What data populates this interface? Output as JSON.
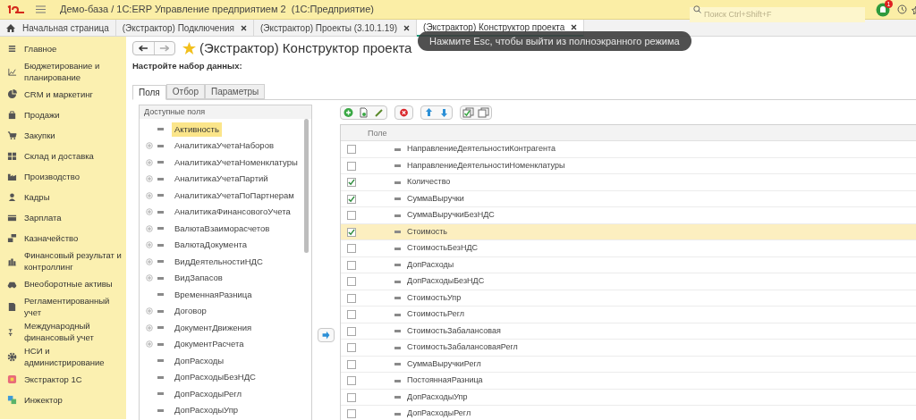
{
  "window": {
    "title": "Демо-база / 1С:ERP Управление предприятием 2  (1С:Предприятие)"
  },
  "search": {
    "placeholder": "Поиск Ctrl+Shift+F"
  },
  "notifications": {
    "count": "1"
  },
  "tabs": [
    {
      "label": "Начальная страница",
      "kind": "home",
      "selected": false
    },
    {
      "label": "(Экстрактор) Подключения",
      "kind": "doc",
      "selected": false
    },
    {
      "label": "(Экстрактор) Проекты (3.10.1.19)",
      "kind": "doc",
      "selected": false
    },
    {
      "label": "(Экстрактор) Конструктор проекта",
      "kind": "doc",
      "selected": true
    }
  ],
  "toast": "Нажмите Esc, чтобы выйти из полноэкранного режима",
  "sidebar": {
    "items": [
      {
        "label": "Главное"
      },
      {
        "label": "Бюджетирование и планирование"
      },
      {
        "label": "CRM и маркетинг"
      },
      {
        "label": "Продажи"
      },
      {
        "label": "Закупки"
      },
      {
        "label": "Склад и доставка"
      },
      {
        "label": "Производство"
      },
      {
        "label": "Кадры"
      },
      {
        "label": "Зарплата"
      },
      {
        "label": "Казначейство"
      },
      {
        "label": "Финансовый результат и контроллинг"
      },
      {
        "label": "Внеоборотные активы"
      },
      {
        "label": "Регламентированный учет"
      },
      {
        "label": "Международный финансовый учет"
      },
      {
        "label": "НСИ и администрирование"
      },
      {
        "label": "Экстрактор 1С"
      },
      {
        "label": "Инжектор"
      }
    ]
  },
  "form": {
    "title": "(Экстрактор) Конструктор проекта",
    "subtitle": "Настройте набор данных:",
    "tabs": [
      {
        "label": "Поля",
        "selected": true
      },
      {
        "label": "Отбор",
        "selected": false
      },
      {
        "label": "Параметры",
        "selected": false
      }
    ],
    "available": {
      "header": "Доступные поля",
      "items": [
        {
          "label": "Активность",
          "expandable": false,
          "selected": true
        },
        {
          "label": "АналитикаУчетаНаборов",
          "expandable": true,
          "selected": false
        },
        {
          "label": "АналитикаУчетаНоменклатуры",
          "expandable": true,
          "selected": false
        },
        {
          "label": "АналитикаУчетаПартий",
          "expandable": true,
          "selected": false
        },
        {
          "label": "АналитикаУчетаПоПартнерам",
          "expandable": true,
          "selected": false
        },
        {
          "label": "АналитикаФинансовогоУчета",
          "expandable": true,
          "selected": false
        },
        {
          "label": "ВалютаВзаиморасчетов",
          "expandable": true,
          "selected": false
        },
        {
          "label": "ВалютаДокумента",
          "expandable": true,
          "selected": false
        },
        {
          "label": "ВидДеятельностиНДС",
          "expandable": true,
          "selected": false
        },
        {
          "label": "ВидЗапасов",
          "expandable": true,
          "selected": false
        },
        {
          "label": "ВременнаяРазница",
          "expandable": false,
          "selected": false
        },
        {
          "label": "Договор",
          "expandable": true,
          "selected": false
        },
        {
          "label": "ДокументДвижения",
          "expandable": true,
          "selected": false
        },
        {
          "label": "ДокументРасчета",
          "expandable": true,
          "selected": false
        },
        {
          "label": "ДопРасходы",
          "expandable": false,
          "selected": false
        },
        {
          "label": "ДопРасходыБезНДС",
          "expandable": false,
          "selected": false
        },
        {
          "label": "ДопРасходыРегл",
          "expandable": false,
          "selected": false
        },
        {
          "label": "ДопРасходыУпр",
          "expandable": false,
          "selected": false
        }
      ]
    },
    "table": {
      "columns": [
        "Поле"
      ],
      "rows": [
        {
          "field": "НаправлениеДеятельностиКонтрагента",
          "checked": false,
          "selected": false
        },
        {
          "field": "НаправлениеДеятельностиНоменклатуры",
          "checked": false,
          "selected": false
        },
        {
          "field": "Количество",
          "checked": true,
          "selected": false
        },
        {
          "field": "СуммаВыручки",
          "checked": true,
          "selected": false
        },
        {
          "field": "СуммаВыручкиБезНДС",
          "checked": false,
          "selected": false
        },
        {
          "field": "Стоимость",
          "checked": true,
          "selected": true
        },
        {
          "field": "СтоимостьБезНДС",
          "checked": false,
          "selected": false
        },
        {
          "field": "ДопРасходы",
          "checked": false,
          "selected": false
        },
        {
          "field": "ДопРасходыБезНДС",
          "checked": false,
          "selected": false
        },
        {
          "field": "СтоимостьУпр",
          "checked": false,
          "selected": false
        },
        {
          "field": "СтоимостьРегл",
          "checked": false,
          "selected": false
        },
        {
          "field": "СтоимостьЗабалансовая",
          "checked": false,
          "selected": false
        },
        {
          "field": "СтоимостьЗабалансоваяРегл",
          "checked": false,
          "selected": false
        },
        {
          "field": "СуммаВыручкиРегл",
          "checked": false,
          "selected": false
        },
        {
          "field": "ПостояннаяРазница",
          "checked": false,
          "selected": false
        },
        {
          "field": "ДопРасходыУпр",
          "checked": false,
          "selected": false
        },
        {
          "field": "ДопРасходыРегл",
          "checked": false,
          "selected": false
        }
      ]
    }
  }
}
